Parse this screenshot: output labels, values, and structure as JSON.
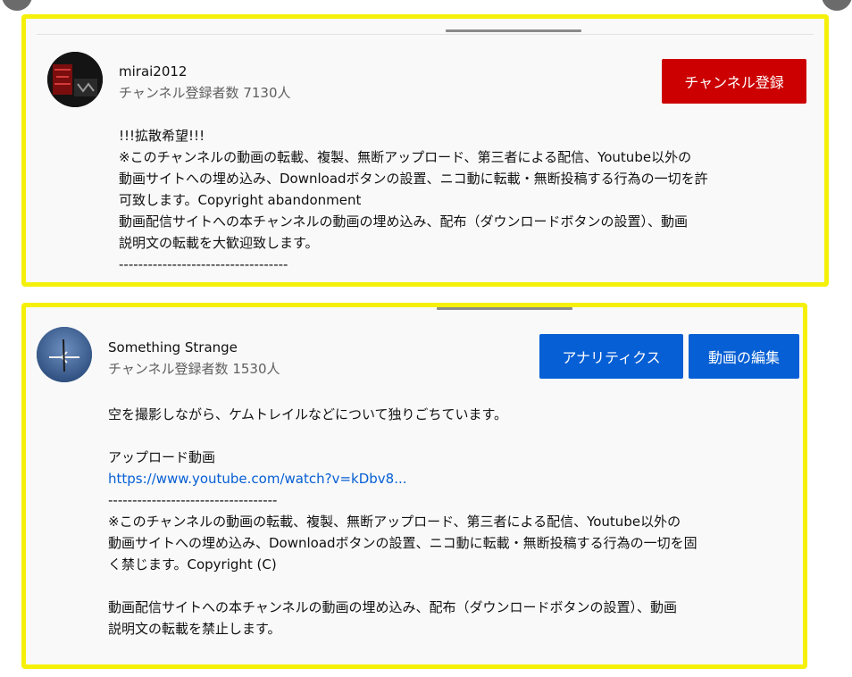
{
  "card1": {
    "channel_name": "mirai2012",
    "subscriber_text": "チャンネル登録者数 7130人",
    "subscribe_button": "チャンネル登録",
    "avatar_icon": "channel-avatar-icon",
    "description_lines": [
      "!!!拡散希望!!!",
      "※このチャンネルの動画の転載、複製、無断アップロード、第三者による配信、Youtube以外の",
      "動画サイトへの埋め込み、Downloadボタンの設置、ニコ動に転載・無断投稿する行為の一切を許",
      "可致します。Copyright abandonment",
      "動画配信サイトへの本チャンネルの動画の埋め込み、配布（ダウンロードボタンの設置）、動画",
      "説明文の転載を大歓迎致します。",
      "-----------------------------------"
    ]
  },
  "card2": {
    "channel_name": "Something Strange",
    "subscriber_text": "チャンネル登録者数 1530人",
    "analytics_button": "アナリティクス",
    "edit_button": "動画の編集",
    "avatar_icon": "channel-avatar-icon",
    "description": {
      "intro": "空を撮影しながら、ケムトレイルなどについて独りごちています。",
      "upload_label": "アップロード動画",
      "upload_link": "https://www.youtube.com/watch?v=kDbv8...",
      "separator": "-----------------------------------",
      "notice_lines": [
        "※このチャンネルの動画の転載、複製、無断アップロード、第三者による配信、Youtube以外の",
        "動画サイトへの埋め込み、Downloadボタンの設置、ニコ動に転載・無断投稿する行為の一切を固",
        "く禁じます。Copyright (C)"
      ],
      "embed_lines": [
        "動画配信サイトへの本チャンネルの動画の埋め込み、配布（ダウンロードボタンの設置）、動画",
        "説明文の転載を禁止します。"
      ]
    }
  },
  "colors": {
    "highlight_border": "#f5f00a",
    "subscribe_red": "#cc0000",
    "action_blue": "#065fd4",
    "link_blue": "#065fd4"
  }
}
